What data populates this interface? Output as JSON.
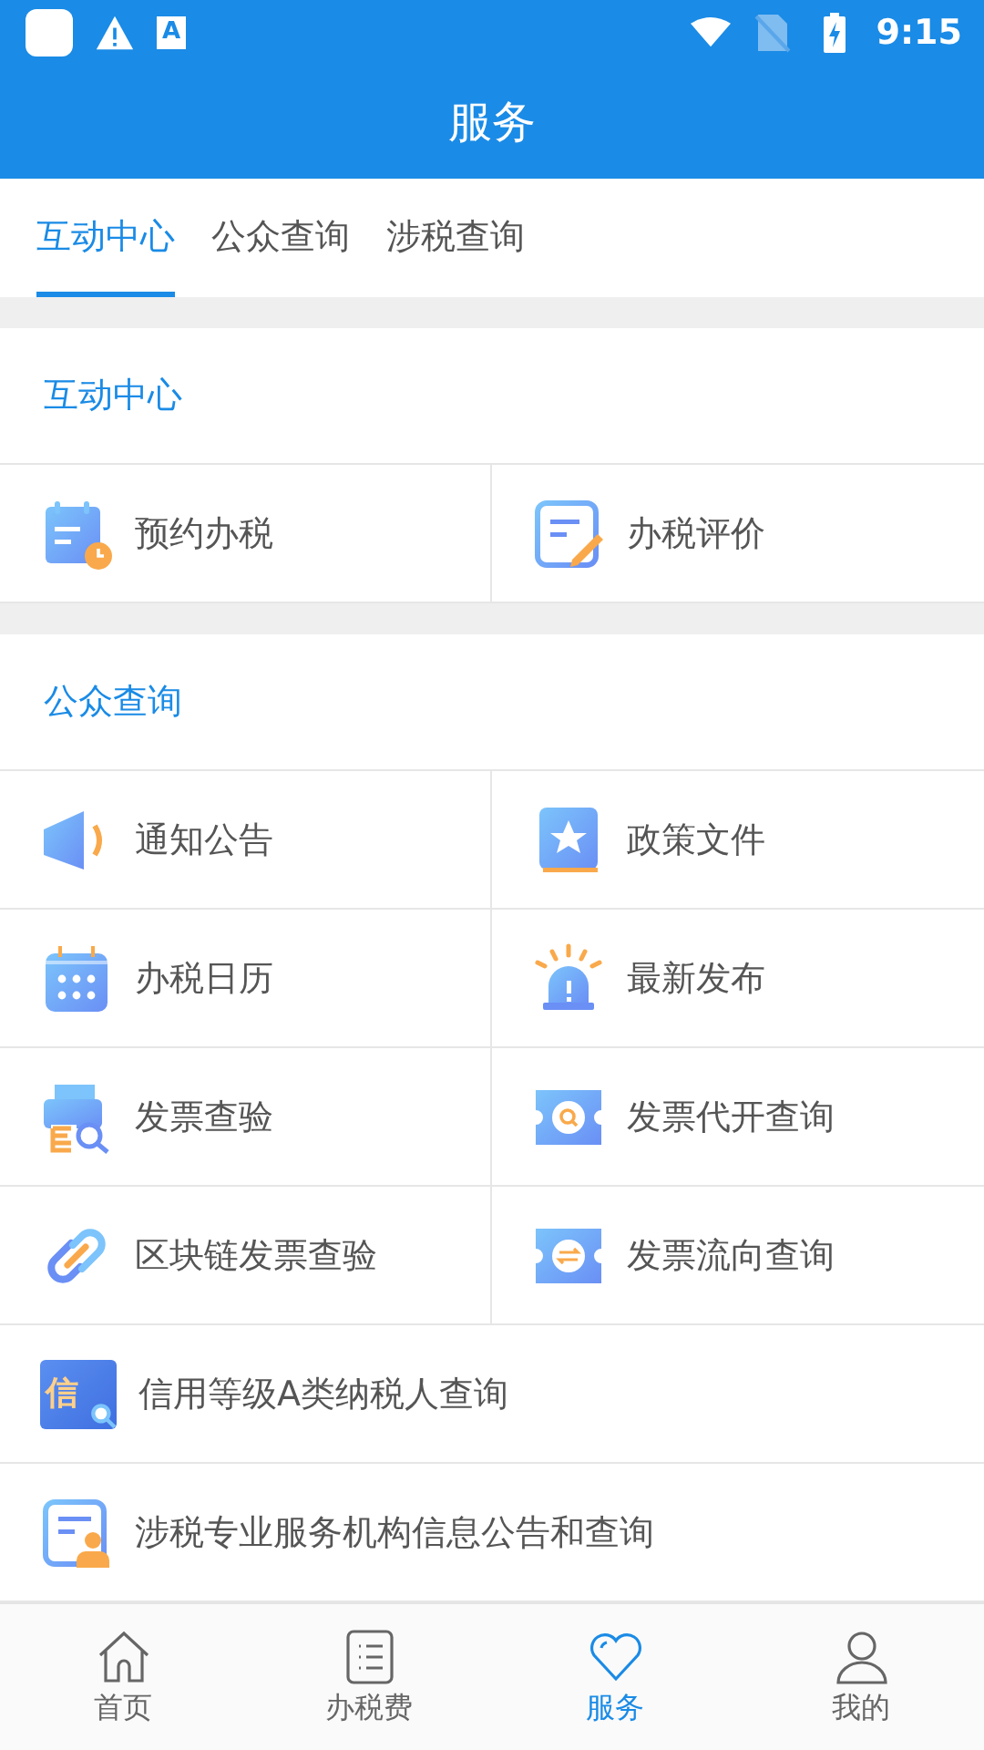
{
  "status_bar": {
    "glyph": "A",
    "time": "9:15"
  },
  "app_bar": {
    "title": "服务"
  },
  "tabs": [
    {
      "label": "互动中心",
      "selected": true
    },
    {
      "label": "公众查询",
      "selected": false
    },
    {
      "label": "涉税查询",
      "selected": false
    }
  ],
  "sections": [
    {
      "title": "互动中心",
      "items": [
        {
          "label": "预约办税",
          "kind": "appointment"
        },
        {
          "label": "办税评价",
          "kind": "review"
        }
      ]
    },
    {
      "title": "公众查询",
      "items": [
        {
          "label": "通知公告",
          "kind": "megaphone"
        },
        {
          "label": "政策文件",
          "kind": "book"
        },
        {
          "label": "办税日历",
          "kind": "calendar"
        },
        {
          "label": "最新发布",
          "kind": "alarm"
        },
        {
          "label": "发票查验",
          "kind": "printer"
        },
        {
          "label": "发票代开查询",
          "kind": "ticket-search"
        },
        {
          "label": "区块链发票查验",
          "kind": "link"
        },
        {
          "label": "发票流向查询",
          "kind": "ticket-flow"
        }
      ],
      "wide_items": [
        {
          "label": "信用等级A类纳税人查询",
          "kind": "credit",
          "glyph": "信"
        },
        {
          "label": "涉税专业服务机构信息公告和查询",
          "kind": "agent"
        }
      ]
    }
  ],
  "bottom_nav": [
    {
      "label": "首页",
      "kind": "home",
      "selected": false
    },
    {
      "label": "办税费",
      "kind": "list",
      "selected": false
    },
    {
      "label": "服务",
      "kind": "heart",
      "selected": true
    },
    {
      "label": "我的",
      "kind": "person",
      "selected": false
    }
  ]
}
